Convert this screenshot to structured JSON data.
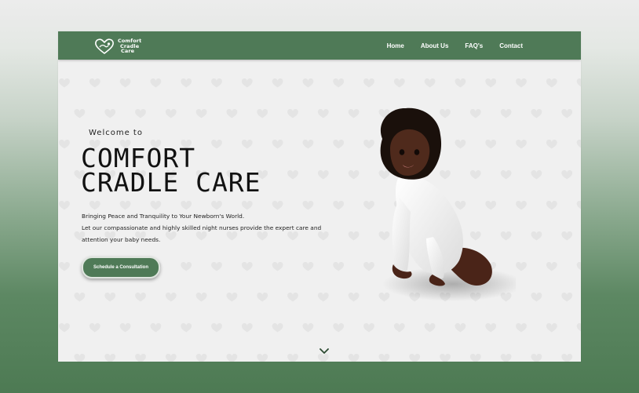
{
  "brand": {
    "logo_line1": "Comfort",
    "logo_line2": "Cradle",
    "logo_line3": "Care"
  },
  "nav": {
    "items": [
      {
        "label": "Home"
      },
      {
        "label": "About Us"
      },
      {
        "label": "FAQ's"
      },
      {
        "label": "Contact"
      }
    ]
  },
  "hero": {
    "welcome": "Welcome to",
    "title_line1": "COMFORT",
    "title_line2": "CRADLE CARE",
    "copy_line1": "Bringing Peace and Tranquility to Your Newborn's World.",
    "copy_line2": "Let our compassionate and highly skilled night nurses provide the expert care and",
    "copy_line3": "attention your baby needs.",
    "cta_label": "Schedule a Consultation"
  },
  "colors": {
    "brand_green": "#4f7a57",
    "hero_background": "#f0f0f0",
    "heart_pattern": "#e4e4e4"
  },
  "icons": {
    "logo": "heart-hand-logo-icon",
    "scroll": "chevron-down-icon",
    "pattern": "heart-icon"
  }
}
